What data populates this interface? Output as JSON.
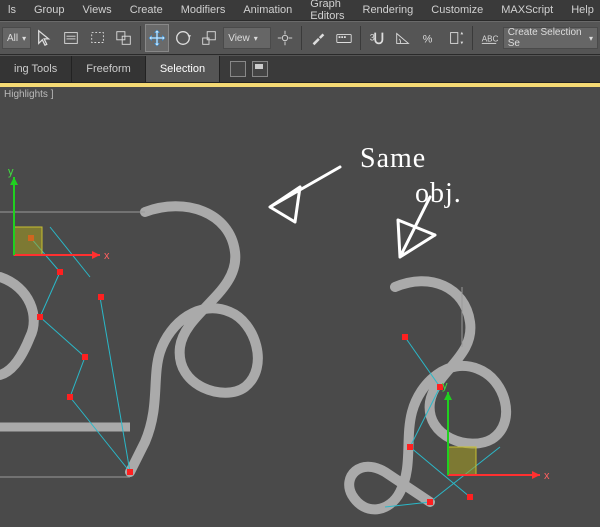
{
  "menu": {
    "items": [
      "ls",
      "Group",
      "Views",
      "Create",
      "Modifiers",
      "Animation",
      "Graph Editors",
      "Rendering",
      "Customize",
      "MAXScript",
      "Help"
    ]
  },
  "toolbar": {
    "filter_drop": "All",
    "view_drop": "View",
    "selset_label": "Create Selection Se"
  },
  "ribbon": {
    "tabs": [
      "ing Tools",
      "Freeform",
      "Selection"
    ]
  },
  "viewport": {
    "label": "Highlights ]",
    "axis": {
      "x": "x",
      "y": "y"
    }
  },
  "annotation": {
    "line1": "Same",
    "line2": "obj."
  }
}
